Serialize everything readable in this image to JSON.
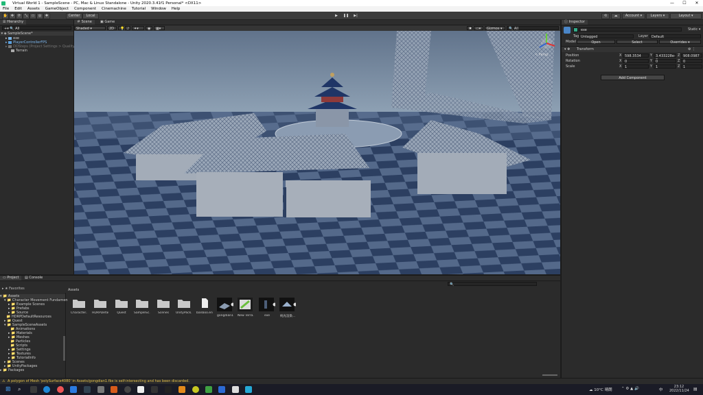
{
  "window": {
    "title": "Virtual World 1 - SampleScene - PC, Mac & Linux Standalone - Unity 2020.3.41f1 Personal* <DX11>",
    "min": "—",
    "max": "☐",
    "close": "✕"
  },
  "menu": [
    "File",
    "Edit",
    "Assets",
    "GameObject",
    "Component",
    "Cinemachine",
    "Tutorial",
    "Window",
    "Help"
  ],
  "toolbar": {
    "pivot": "Center",
    "space": "Local",
    "account": "Account",
    "layers": "Layers",
    "layout": "Layout"
  },
  "hierarchy": {
    "tab": "Hierarchy",
    "search": "All",
    "items": [
      "SampleScene*",
      "exe",
      "PlayerControllerFPS",
      "DDSteps (Project Settings > Quality)",
      "Terrain"
    ]
  },
  "scene": {
    "tabs": [
      "Scene",
      "Game"
    ],
    "shading": "Shaded",
    "mode": "2D",
    "gizmos": "Gizmos",
    "search": "All",
    "persp": "< Persp"
  },
  "inspector": {
    "tab": "Inspector",
    "name": "exe",
    "static": "Static",
    "tag_label": "Tag",
    "tag": "Untagged",
    "layer_label": "Layer",
    "layer": "Default",
    "model_label": "Model",
    "open": "Open",
    "select": "Select",
    "overrides": "Overrides",
    "transform": "Transform",
    "position_label": "Position",
    "position": {
      "x": "598.3534",
      "y": "3.433228e-0",
      "z": "908.0987"
    },
    "rotation_label": "Rotation",
    "rotation": {
      "x": "0",
      "y": "0",
      "z": "0"
    },
    "scale_label": "Scale",
    "scale": {
      "x": "1",
      "y": "1",
      "z": "1"
    },
    "add_component": "Add Component",
    "axis": {
      "x": "X",
      "y": "Y",
      "z": "Z"
    }
  },
  "project": {
    "tabs": [
      "Project",
      "Console"
    ],
    "favorites": "Favorites",
    "tree": [
      "Assets",
      "Character Movement Fundamen",
      "Example Scenes",
      "Prefabs",
      "Source",
      "HDRPDefaultResources",
      "Quest",
      "SampleSceneAssets",
      "Animations",
      "Materials",
      "Meshes",
      "Particles",
      "Scripts",
      "Settings",
      "Textures",
      "TutorialInfo",
      "Scenes",
      "UnityPackages",
      "Packages"
    ],
    "breadcrumb": "Assets",
    "assets": [
      "Character...",
      "HDRPDefau...",
      "Quest",
      "SampleSc...",
      "Scenes",
      "UnityPack...",
      "banboo.eng...",
      "gongdian1",
      "New Terra...",
      "exe",
      "纯光渲染..."
    ]
  },
  "status": {
    "message": "A polygon of Mesh 'polySurface4080' in Assets/gongdian1.fbx is self-intersecting and has been discarded."
  },
  "taskbar": {
    "weather": "10°C",
    "weather_desc": "晴朗",
    "time": "23:12",
    "date": "2022/11/24",
    "lang": "中"
  },
  "colors": {
    "sky": "#7b91a8",
    "floor_dark": "#2a3f62",
    "floor_light": "#5c7494",
    "accent": "#2c5d87"
  }
}
